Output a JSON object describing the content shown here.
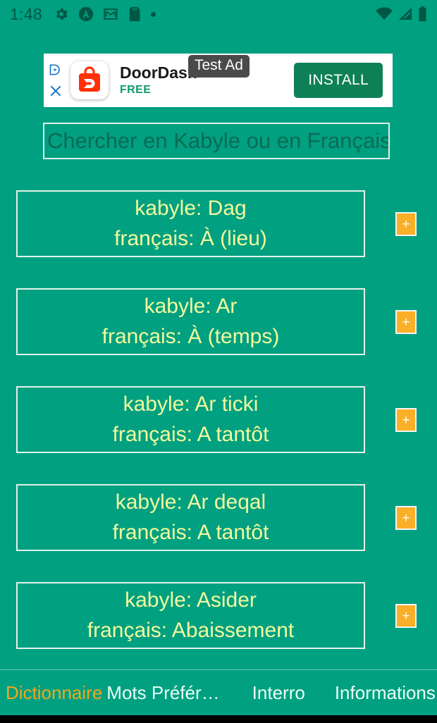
{
  "theme": {
    "background": "#00A080",
    "card_border": "#E2F2EC",
    "card_text": "#F2FA9E",
    "accent_orange": "#FAAF28",
    "status_icon": "#005744",
    "nav_active": "#F2A71B",
    "nav_inactive": "#E8FFF8"
  },
  "statusbar": {
    "clock": "1:48",
    "left_icons": [
      "gear-icon",
      "circle-a-icon",
      "gmail-icon",
      "sd-card-icon",
      "dot-icon"
    ],
    "right_icons": [
      "wifi-icon",
      "cellular-signal-icon",
      "battery-icon"
    ]
  },
  "ad": {
    "badge": "Test Ad",
    "title": "DoorDash",
    "subtitle": "FREE",
    "install_label": "INSTALL",
    "adchoices_icon": "adchoices-icon",
    "close_icon": "close-icon",
    "app_icon": "doordash-bag-icon"
  },
  "search": {
    "placeholder": "Chercher en Kabyle ou en Français",
    "value": ""
  },
  "results": [
    {
      "kabyle": "kabyle: Dag",
      "francais": "français: À (lieu)",
      "add_label": "+"
    },
    {
      "kabyle": "kabyle: Ar",
      "francais": "français: À (temps)",
      "add_label": "+"
    },
    {
      "kabyle": "kabyle: Ar ticki",
      "francais": "français: A tantôt",
      "add_label": "+"
    },
    {
      "kabyle": "kabyle: Ar deqal",
      "francais": "français: A tantôt",
      "add_label": "+"
    },
    {
      "kabyle": "kabyle: Asider",
      "francais": "français: Abaissement",
      "add_label": "+"
    }
  ],
  "bottom_nav": {
    "items": [
      {
        "label": "Dictionnaire",
        "active": true
      },
      {
        "label": "Mots Préfér…",
        "active": false
      },
      {
        "label": "Interro",
        "active": false
      },
      {
        "label": "Informations",
        "active": false
      }
    ]
  }
}
